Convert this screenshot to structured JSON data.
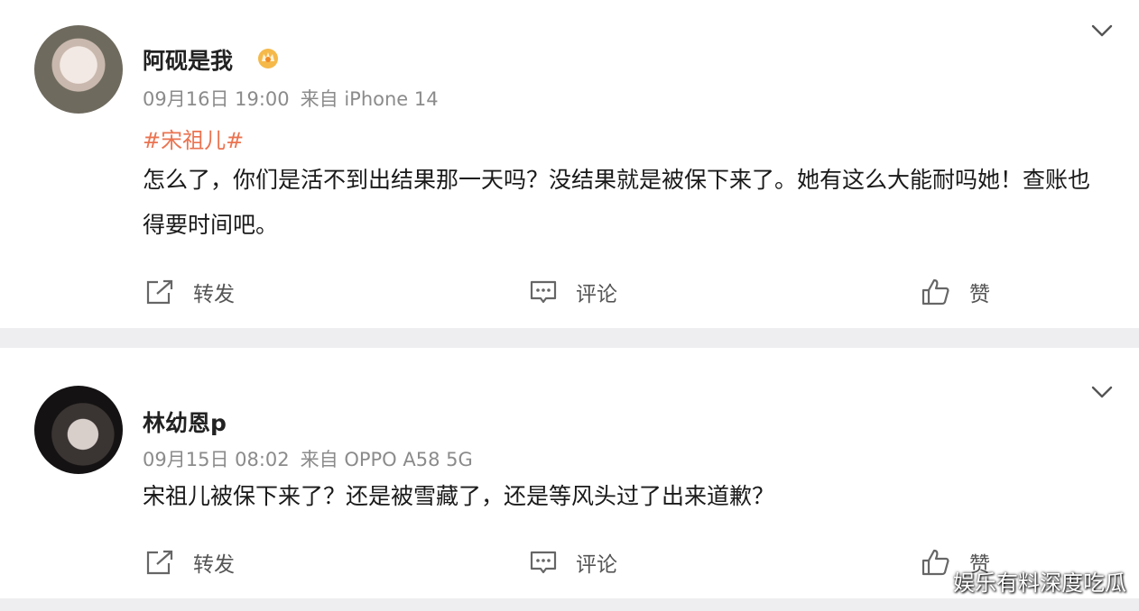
{
  "posts": [
    {
      "username": "阿砚是我",
      "date": "09月16日 19:00",
      "source": "来自 iPhone 14",
      "topic": "#宋祖儿#",
      "content": "怎么了，你们是活不到出结果那一天吗？没结果就是被保下来了。她有这么大能耐吗她！查账也得要时间吧。",
      "actions": {
        "repost": "转发",
        "comment": "评论",
        "like": "赞"
      }
    },
    {
      "username": "林幼恩p",
      "date": "09月15日 08:02",
      "source": "来自 OPPO A58 5G",
      "content": "宋祖儿被保下来了？还是被雪藏了，还是等风头过了出来道歉？",
      "actions": {
        "repost": "转发",
        "comment": "评论",
        "like": "赞"
      }
    }
  ],
  "watermark": "娱乐有料深度吃瓜",
  "colors": {
    "topic": "#eb7350",
    "username": "#222222",
    "meta": "#8b8b8b"
  }
}
